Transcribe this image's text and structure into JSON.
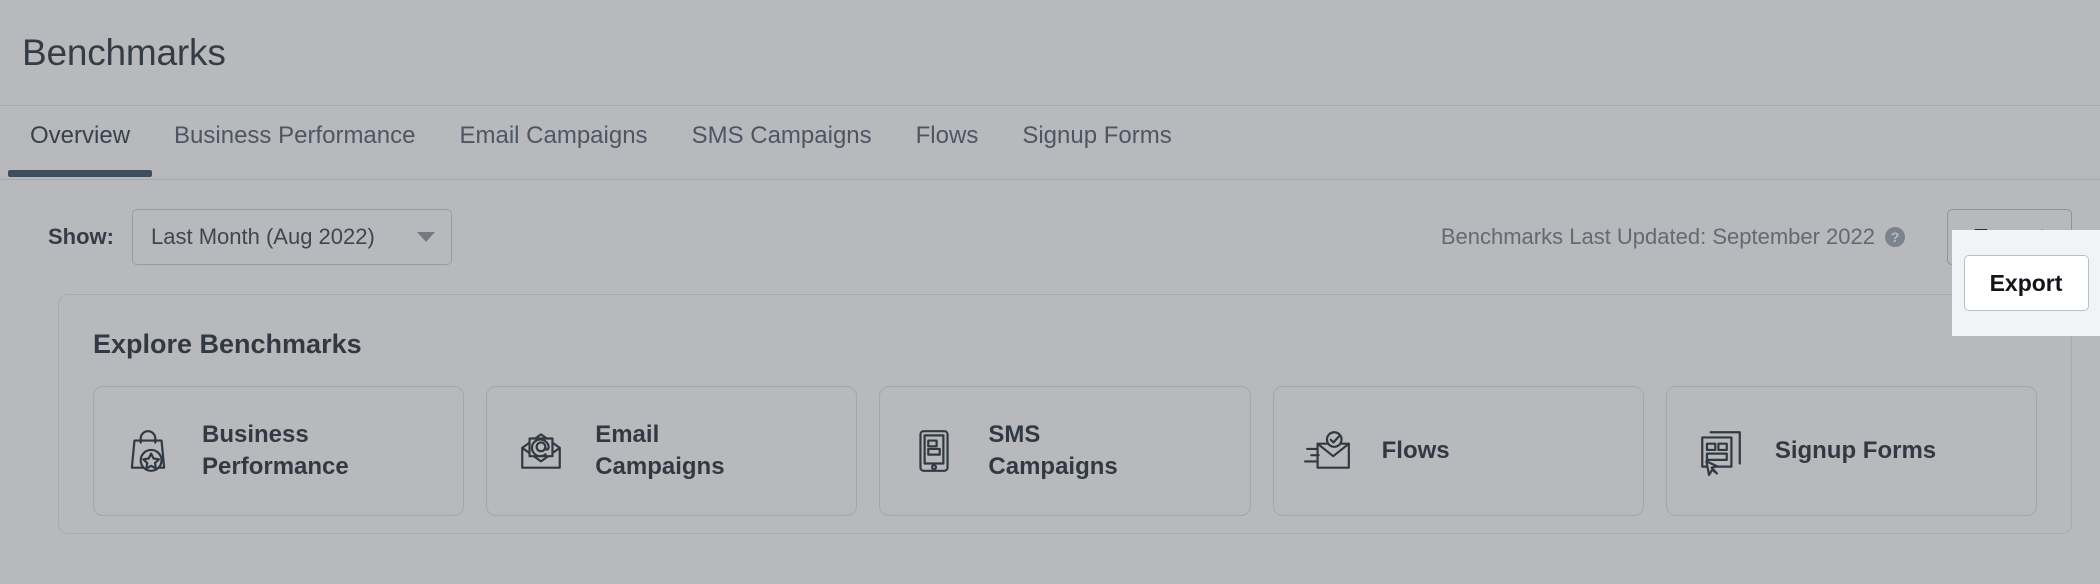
{
  "header": {
    "title": "Benchmarks"
  },
  "tabs": [
    {
      "label": "Overview",
      "active": true
    },
    {
      "label": "Business Performance",
      "active": false
    },
    {
      "label": "Email Campaigns",
      "active": false
    },
    {
      "label": "SMS Campaigns",
      "active": false
    },
    {
      "label": "Flows",
      "active": false
    },
    {
      "label": "Signup Forms",
      "active": false
    }
  ],
  "controls": {
    "show_label": "Show:",
    "date_range_value": "Last Month  (Aug 2022)",
    "dropdown_icon": "chevron-down-icon",
    "last_updated_text": "Benchmarks Last Updated: September 2022",
    "help_icon": "help-circle-icon",
    "help_glyph": "?",
    "export_label": "Export"
  },
  "explore": {
    "title": "Explore Benchmarks",
    "cards": [
      {
        "label": "Business\nPerformance",
        "line1": "Business",
        "line2": "Performance",
        "icon": "shopping-bag-star-icon"
      },
      {
        "label": "Email\nCampaigns",
        "line1": "Email",
        "line2": "Campaigns",
        "icon": "open-envelope-at-icon"
      },
      {
        "label": "SMS\nCampaigns",
        "line1": "SMS",
        "line2": "Campaigns",
        "icon": "mobile-phone-message-icon"
      },
      {
        "label": "Flows",
        "line1": "Flows",
        "line2": "",
        "icon": "envelope-check-motion-icon"
      },
      {
        "label": "Signup Forms",
        "line1": "Signup Forms",
        "line2": "",
        "icon": "form-window-cursor-icon"
      }
    ]
  },
  "colors": {
    "accent": "#32465a",
    "text_primary": "#1b242d",
    "text_muted": "#6f7782",
    "panel_border": "#e3e5e8",
    "dim_overlay": "rgba(83,89,96,0.42)",
    "spotlight_bg": "#f2f3f5"
  },
  "overlay": {
    "highlighted_element": "export-button"
  }
}
